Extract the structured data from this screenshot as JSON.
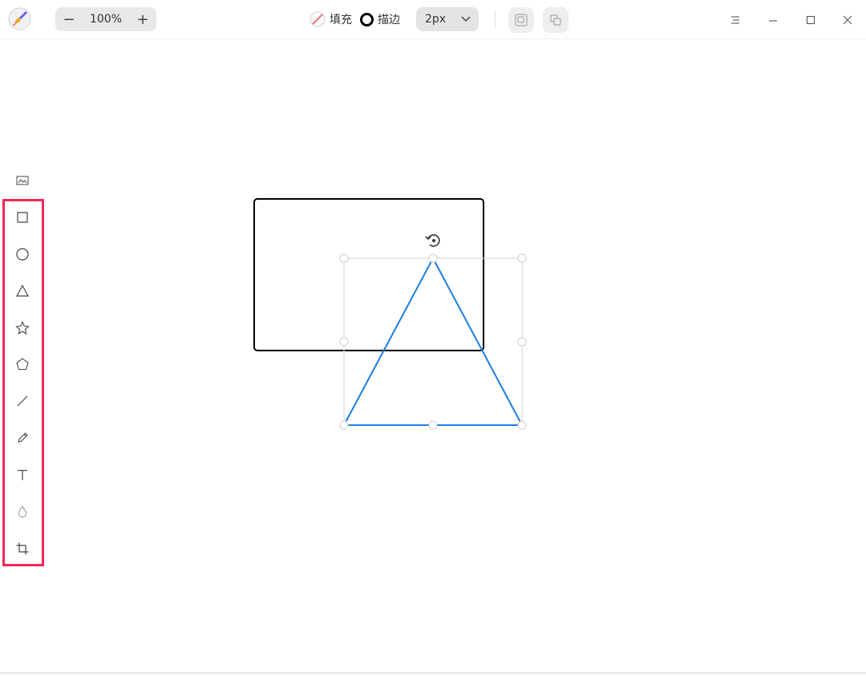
{
  "zoom": {
    "minus_label": "−",
    "value": "100%",
    "plus_label": "+"
  },
  "attributes": {
    "fill_label": "填充",
    "stroke_label": "描边",
    "stroke_width": "2px",
    "stroke_color": "#000000",
    "fill_icon": "no-fill-icon"
  },
  "layer_buttons": [
    "bring-to-front-icon",
    "send-to-back-icon"
  ],
  "window_controls": [
    "menu-icon",
    "minimize-icon",
    "maximize-icon",
    "close-icon"
  ],
  "tools": [
    "image-icon",
    "rectangle-icon",
    "ellipse-icon",
    "triangle-icon",
    "star-icon",
    "polygon-icon",
    "line-icon",
    "pencil-icon",
    "text-icon",
    "blur-icon",
    "crop-icon"
  ],
  "canvas": {
    "shapes": [
      {
        "type": "rectangle",
        "stroke": "#000000"
      },
      {
        "type": "triangle",
        "stroke": "#1a7ee0",
        "selected": true
      }
    ]
  },
  "colors": {
    "accent": "#1a7ee0",
    "highlight": "#f02856",
    "selection": "#d8d8d8"
  }
}
